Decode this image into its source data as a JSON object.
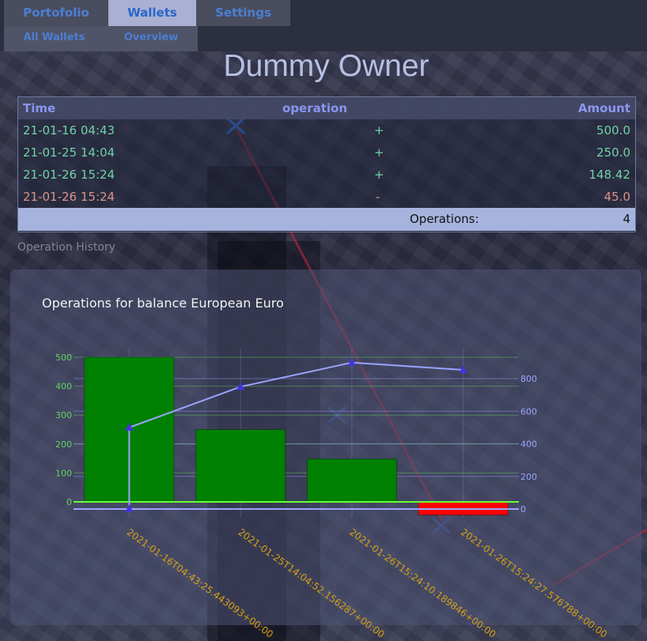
{
  "nav": {
    "tabs": [
      {
        "label": "Portofolio"
      },
      {
        "label": "Wallets"
      },
      {
        "label": "Settings"
      }
    ],
    "subtabs": [
      {
        "label": "All Wallets"
      },
      {
        "label": "Overview"
      }
    ]
  },
  "owner": "Dummy Owner",
  "table": {
    "headers": {
      "time": "Time",
      "operation": "operation",
      "amount": "Amount"
    },
    "rows": [
      {
        "time": "21-01-16 04:43",
        "op": "+",
        "amount": "500.0"
      },
      {
        "time": "21-01-25 14:04",
        "op": "+",
        "amount": "250.0"
      },
      {
        "time": "21-01-26 15:24",
        "op": "+",
        "amount": "148.42"
      },
      {
        "time": "21-01-26 15:24",
        "op": "-",
        "amount": "45.0"
      }
    ],
    "footer": {
      "label": "Operations:",
      "count": "4"
    }
  },
  "history_label": "Operation History",
  "chart_data": {
    "type": "bar",
    "title": "Operations for balance European Euro",
    "categories": [
      "2021-01-16T04:43:25.443093+00:00",
      "2021-01-25T14:04:52.156287+00:00",
      "2021-01-26T15:24:10.189846+00:00",
      "2021-01-26T15:24:27.576788+00:00"
    ],
    "series": [
      {
        "type": "bar",
        "axis": "left",
        "values": [
          500.0,
          250.0,
          148.42,
          -45.0
        ]
      },
      {
        "type": "line",
        "axis": "right",
        "values": [
          500.0,
          750.0,
          898.42,
          853.42
        ]
      }
    ],
    "left_axis": {
      "ticks": [
        0,
        100,
        200,
        300,
        400,
        500
      ],
      "range": [
        -45,
        500
      ]
    },
    "right_axis": {
      "ticks": [
        0,
        200,
        400,
        600,
        800
      ],
      "range": [
        0,
        898.42
      ]
    },
    "colors": {
      "positive": "#008000",
      "negative": "#ff0000",
      "line": "#9aa4ff",
      "left_tick": "#5fd35f",
      "right_tick": "#9aa4ff",
      "category": "#d4a017"
    }
  }
}
